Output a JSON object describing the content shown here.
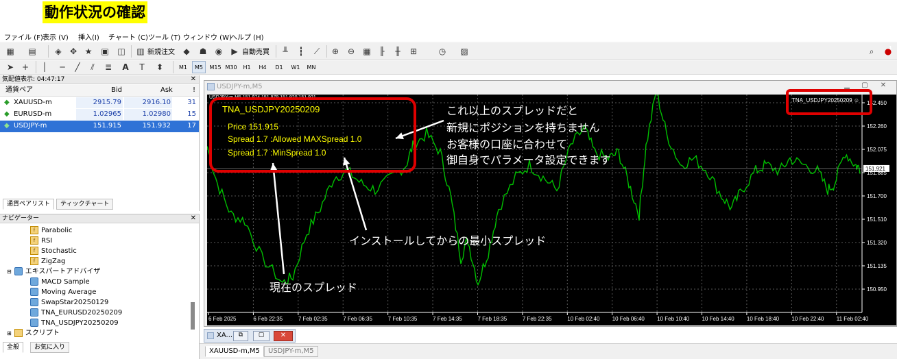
{
  "page_title": "動作状況の確認",
  "menu": [
    "ファイル (F)",
    "表示 (V)",
    "挿入(I)",
    "チャート (C)",
    "ツール (T)",
    "ウィンドウ (W)",
    "ヘルプ (H)"
  ],
  "toolbar": {
    "new_order": "新規注文",
    "auto_trading": "自動売買",
    "timeframes": [
      "M1",
      "M5",
      "M15",
      "M30",
      "H1",
      "H4",
      "D1",
      "W1",
      "MN"
    ],
    "active_timeframe": "M5",
    "notification_count": "1"
  },
  "market_watch": {
    "header": "気配値表示: 04:47:17",
    "columns": [
      "通貨ペア",
      "Bid",
      "Ask",
      "!"
    ],
    "rows": [
      {
        "symbol": "XAUUSD-m",
        "bid": "2915.79",
        "ask": "2916.10",
        "spread": "31"
      },
      {
        "symbol": "EURUSD-m",
        "bid": "1.02965",
        "ask": "1.02980",
        "spread": "15"
      },
      {
        "symbol": "USDJPY-m",
        "bid": "151.915",
        "ask": "151.932",
        "spread": "17"
      }
    ],
    "tabs": [
      "通貨ペアリスト",
      "ティックチャート"
    ]
  },
  "navigator": {
    "header": "ナビゲーター",
    "indicators": [
      "Parabolic",
      "RSI",
      "Stochastic",
      "ZigZag"
    ],
    "expert_folder": "エキスパートアドバイザ",
    "experts": [
      "MACD Sample",
      "Moving Average",
      "SwapStar20250129",
      "TNA_EURUSD20250209",
      "TNA_USDJPY20250209"
    ],
    "scripts_folder": "スクリプト",
    "tabs": [
      "全般",
      "お気に入り"
    ]
  },
  "chart": {
    "window_title": "USDJPY-m,M5",
    "ohlc_text": "USDJPY-m,M5  151.974 151.979 151.920 151.921",
    "ea_name": "TNA_USDJPY20250209",
    "ea_badge": "TNA_USDJPY20250209 ☺",
    "info_lines": [
      "Price  151.915",
      "Spread  1.7  :Allowed MAXSpread  1.0",
      "Spread  1.7  :MinSpread  1.0"
    ],
    "current_price": "151.921",
    "y_ticks": [
      "152.450",
      "152.260",
      "152.075",
      "151.885",
      "151.700",
      "151.510",
      "151.320",
      "151.135",
      "150.950"
    ],
    "x_ticks": [
      "6 Feb 2025",
      "6 Feb 22:35",
      "7 Feb 02:35",
      "7 Feb 06:35",
      "7 Feb 10:35",
      "7 Feb 14:35",
      "7 Feb 18:35",
      "7 Feb 22:35",
      "10 Feb 02:40",
      "10 Feb 06:40",
      "10 Feb 10:40",
      "10 Feb 14:40",
      "10 Feb 18:40",
      "10 Feb 22:40",
      "11 Feb 02:40"
    ],
    "line_color": "#00c000",
    "background": "#000000",
    "highlight_color": "#e00000"
  },
  "annotations": {
    "maxspread_note": [
      "これ以上のスプレッドだと",
      "新規にポジションを持ちません",
      "お客様の口座に合わせて",
      "御自身でパラメータ設定できます"
    ],
    "min_spread_note": "インストールしてからの最小スプレッド",
    "current_spread_note": "現在のスプレッド"
  },
  "bottom": {
    "mini_window": "XA...",
    "chart_tabs": [
      "XAUUSD-m,M5",
      "USDJPY-m,M5"
    ]
  }
}
